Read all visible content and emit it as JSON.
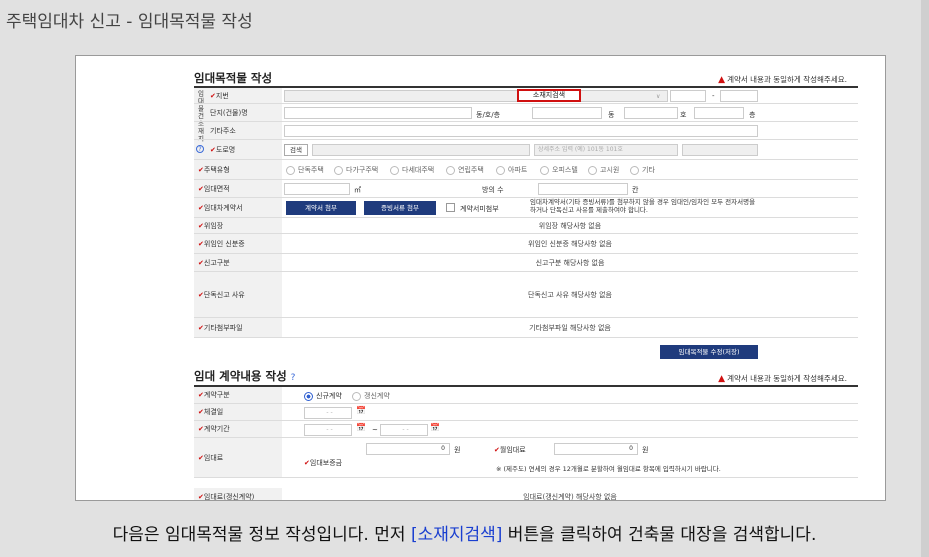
{
  "page_title": "주택임대차 신고 - 임대목적물 작성",
  "caption": {
    "before": "다음은 임대목적물 정보 작성입니다. 먼저 ",
    "highlight": "[소재지검색]",
    "after": " 버튼을 클릭하여 건축물 대장을 검색합니다."
  },
  "section1": {
    "title": "임대목적물 작성",
    "warning": "계약서 내용과 동일하게 작성해주세요.",
    "location_side_label": "임대물건소재지",
    "rows": {
      "jibun": "지번",
      "complex_name": "단지(건물)명",
      "other_address": "기타주소",
      "road_name": "도로명",
      "house_type": "주택유형",
      "area": "임대면적",
      "contract": "임대차계약서",
      "delegation": "위임장",
      "delegate_id": "위임인 신분증",
      "report_type": "신고구분",
      "single_reason": "단독신고 사유",
      "other_attach": "기타첨부파일"
    },
    "location_search_button": "소재지검색",
    "dash": "-",
    "dong_ho_label": "동/호/층",
    "unit_dong": "동",
    "unit_ho": "호",
    "unit_floor": "층",
    "search_button": "검색",
    "detail_address_placeholder": "상세주소 입력 (예) 101동 101호",
    "house_types": [
      "단독주택",
      "다가구주택",
      "다세대주택",
      "연립주택",
      "아파트",
      "오피스텔",
      "고시원",
      "기타"
    ],
    "area_unit": "㎡",
    "room_count_label": "방의 수",
    "room_unit": "칸",
    "attach_contract_button": "계약서 첨부",
    "attach_evidence_button": "증빙서류 첨부",
    "no_contract_label": "계약서미첨부",
    "contract_note": "임대차계약서(기타 증빙서류)를 첨부하지 않을 경우 임대인/임차인 모두 전자서명을 하거나 단독신고 사유를 제출하여야 합니다.",
    "delegation_value": "위임장 해당사항 없음",
    "delegate_id_value": "위임인 신분증 해당사항 없음",
    "report_type_value": "신고구분 해당사항 없음",
    "single_reason_value": "단독신고 사유 해당사항 없음",
    "other_attach_value": "기타첨부파일 해당사항 없음",
    "save_button": "임대목적물 수정(저장)"
  },
  "section2": {
    "title": "임대 계약내용 작성",
    "warning": "계약서 내용과 동일하게 작성해주세요.",
    "rows": {
      "contract_type": "계약구분",
      "sign_date": "체결일",
      "period": "계약기간",
      "rent": "임대료",
      "deposit": "임대보증금",
      "monthly_rent": "월임대료",
      "rent_renewal": "임대료(갱신계약)"
    },
    "contract_types": [
      "신규계약",
      "갱신계약"
    ],
    "date_placeholder": "- -",
    "tilde": "~",
    "deposit_value": "0",
    "monthly_value": "0",
    "won": "원",
    "jeonse_note": "※ (제주도) 연세의 경우 12개월로 분할하여 월임대료 항목에 입력하시기 바랍니다.",
    "renewal_value": "임대료(갱신계약) 해당사항 없음"
  }
}
